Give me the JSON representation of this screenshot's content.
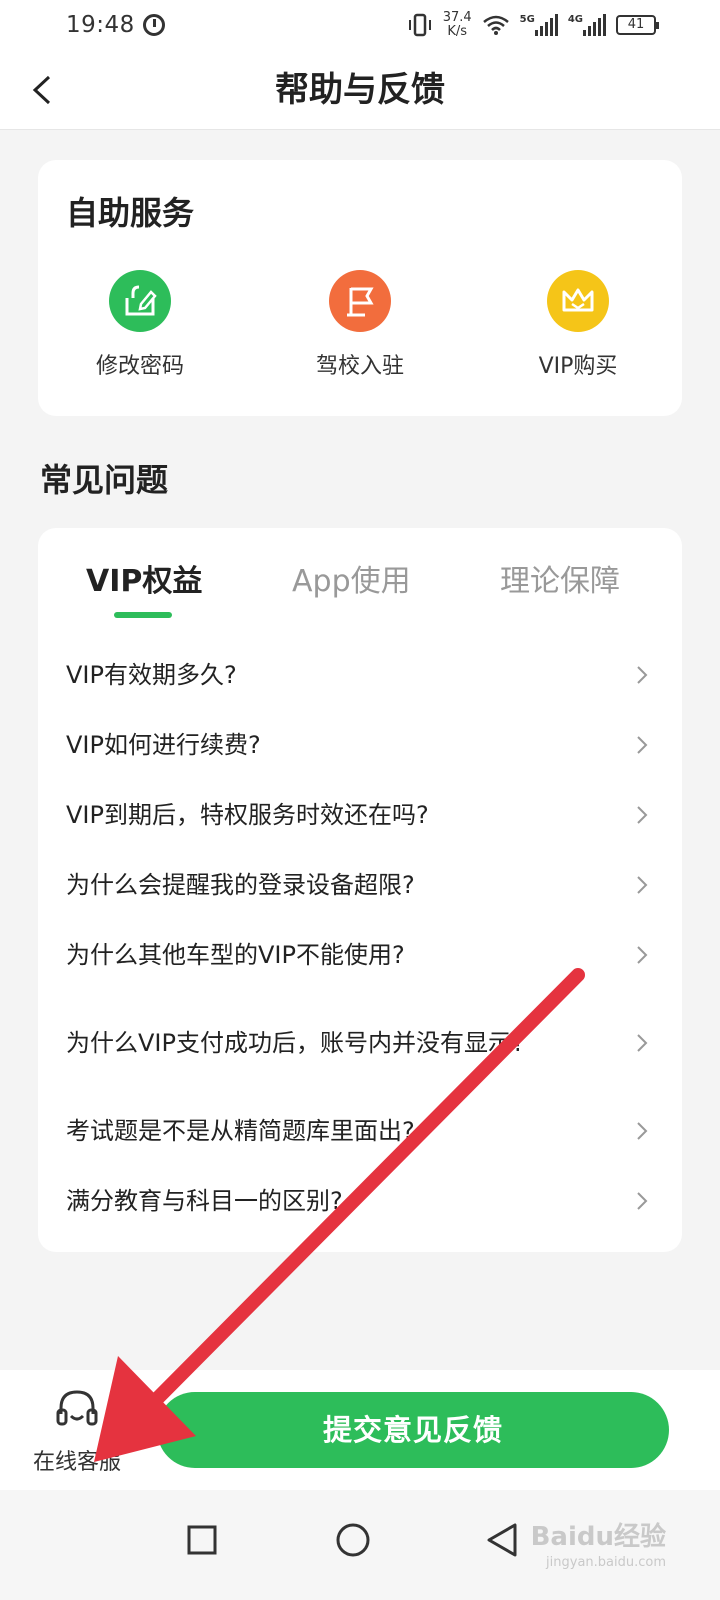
{
  "status_bar": {
    "time": "19:48",
    "net_speed_value": "37.4",
    "net_speed_unit": "K/s",
    "sim1_type": "5G",
    "sim2_type": "4G",
    "battery": "41"
  },
  "nav": {
    "title": "帮助与反馈"
  },
  "self_service": {
    "title": "自助服务",
    "items": [
      {
        "label": "修改密码",
        "icon": "edit-lock-icon",
        "color": "#2dbd5a"
      },
      {
        "label": "驾校入驻",
        "icon": "flag-icon",
        "color": "#f26d3d"
      },
      {
        "label": "VIP购买",
        "icon": "crown-icon",
        "color": "#f5c518"
      }
    ]
  },
  "faq": {
    "section_title": "常见问题",
    "tabs": [
      "VIP权益",
      "App使用",
      "理论保障"
    ],
    "active_tab": 0,
    "items": [
      "VIP有效期多久?",
      "VIP如何进行续费?",
      "VIP到期后，特权服务时效还在吗?",
      "为什么会提醒我的登录设备超限?",
      "为什么其他车型的VIP不能使用?",
      "为什么VIP支付成功后，账号内并没有显示?",
      "考试题是不是从精简题库里面出?",
      "满分教育与科目一的区别?"
    ]
  },
  "bottom": {
    "customer_service_label": "在线客服",
    "submit_label": "提交意见反馈"
  },
  "colors": {
    "accent": "#2dbd5a",
    "arrow": "#e5333f"
  },
  "watermark": {
    "text": "Baidu经验",
    "sub": "jingyan.baidu.com"
  }
}
